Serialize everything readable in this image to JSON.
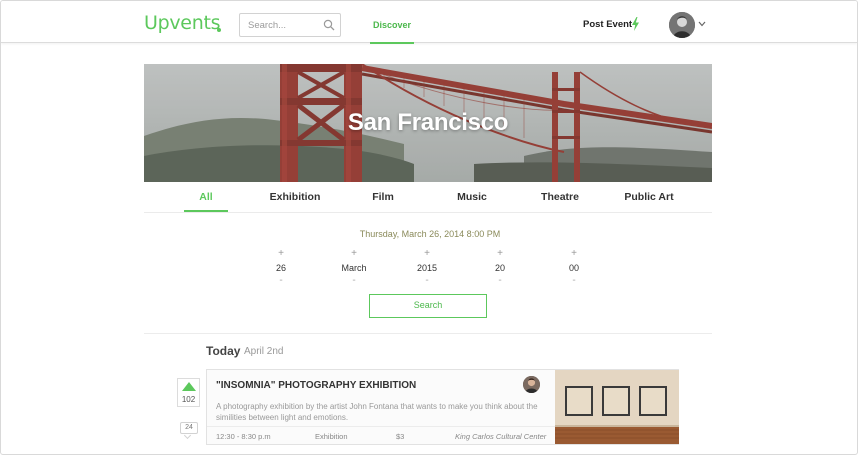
{
  "app": {
    "logo": "Upvents"
  },
  "header": {
    "search_placeholder": "Search...",
    "nav_discover": "Discover",
    "post_event": "Post Event"
  },
  "hero": {
    "city": "San Francisco"
  },
  "tabs": [
    {
      "label": "All",
      "active": true
    },
    {
      "label": "Exhibition"
    },
    {
      "label": "Film"
    },
    {
      "label": "Music"
    },
    {
      "label": "Theatre"
    },
    {
      "label": "Public Art"
    }
  ],
  "date_picker": {
    "display": "Thursday, March 26, 2014 8:00 PM",
    "plus": "+",
    "minus": "-",
    "fields": [
      {
        "name": "day",
        "value": "26"
      },
      {
        "name": "month",
        "value": "March"
      },
      {
        "name": "year",
        "value": "2015"
      },
      {
        "name": "hour",
        "value": "20"
      },
      {
        "name": "minute",
        "value": "00"
      }
    ],
    "search_label": "Search"
  },
  "today": {
    "label": "Today",
    "date": "April 2nd"
  },
  "events": [
    {
      "title": "\"INSOMNIA\" PHOTOGRAPHY EXHIBITION",
      "description": "A photography exhibition by the artist John Fontana that wants to make you think about the similities between light and emotions.",
      "time": "12:30 - 8:30 p.m",
      "category": "Exhibition",
      "price": "$3",
      "venue": "King Carlos Cultural Center",
      "votes": "102",
      "comments": "24"
    }
  ],
  "colors": {
    "accent": "#5cc85c",
    "text": "#333333",
    "muted": "#999999"
  }
}
